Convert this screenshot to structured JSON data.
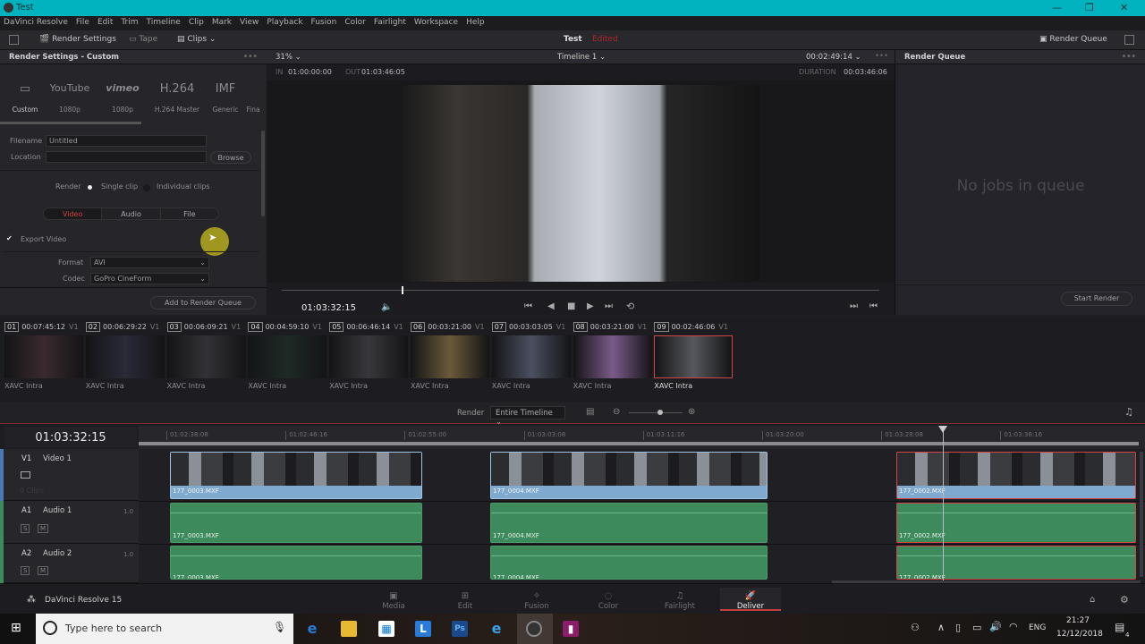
{
  "window": {
    "title": "Test",
    "min": "—",
    "max": "❐",
    "close": "✕"
  },
  "menu": [
    "DaVinci Resolve",
    "File",
    "Edit",
    "Trim",
    "Timeline",
    "Clip",
    "Mark",
    "View",
    "Playback",
    "Fusion",
    "Color",
    "Fairlight",
    "Workspace",
    "Help"
  ],
  "toolbar": {
    "render_settings": "Render Settings",
    "tape": "Tape",
    "clips": "Clips",
    "project": "Test",
    "status": "Edited",
    "render_queue": "Render Queue"
  },
  "render_settings": {
    "title": "Render Settings - Custom",
    "presets": [
      {
        "icon": "▭",
        "label": "Custom"
      },
      {
        "icon": "YouTube",
        "label": "1080p"
      },
      {
        "icon": "vimeo",
        "label": "1080p"
      },
      {
        "icon": "H.264",
        "label": "H.264 Master"
      },
      {
        "icon": "IMF",
        "label": "Generic"
      },
      {
        "icon": "",
        "label": "Fina"
      }
    ],
    "filename_label": "Filename",
    "filename": "Untitled",
    "location_label": "Location",
    "location": "",
    "browse": "Browse",
    "render_label": "Render",
    "single_clip": "Single clip",
    "individual_clips": "Individual clips",
    "tabs": [
      "Video",
      "Audio",
      "File"
    ],
    "export_video": "Export Video",
    "format_label": "Format",
    "format": "AVI",
    "codec_label": "Codec",
    "codec": "GoPro CineForm",
    "add_to_queue": "Add to Render Queue"
  },
  "viewer": {
    "zoom": "31%",
    "timeline": "Timeline 1",
    "timecode": "00:02:49:14",
    "in_label": "IN",
    "in": "01:00:00:00",
    "out_label": "OUT",
    "out": "01:03:46:05",
    "duration_label": "DURATION",
    "duration": "00:03:46:06",
    "current": "01:03:32:15",
    "playhead_fraction": 0.2
  },
  "render_queue": {
    "title": "Render Queue",
    "empty": "No jobs in queue",
    "start": "Start Render"
  },
  "clips": [
    {
      "num": "01",
      "tc": "00:07:45:12",
      "track": "V1",
      "codec": "XAVC Intra",
      "color": "#3a2a2e"
    },
    {
      "num": "02",
      "tc": "00:06:29:22",
      "track": "V1",
      "codec": "XAVC Intra",
      "color": "#2a2a38"
    },
    {
      "num": "03",
      "tc": "00:06:09:21",
      "track": "V1",
      "codec": "XAVC Intra",
      "color": "#323236"
    },
    {
      "num": "04",
      "tc": "00:04:59:10",
      "track": "V1",
      "codec": "XAVC Intra",
      "color": "#1e2a26"
    },
    {
      "num": "05",
      "tc": "00:06:46:14",
      "track": "V1",
      "codec": "XAVC Intra",
      "color": "#38383c"
    },
    {
      "num": "06",
      "tc": "00:03:21:00",
      "track": "V1",
      "codec": "XAVC Intra",
      "color": "#6a5a3a"
    },
    {
      "num": "07",
      "tc": "00:03:03:05",
      "track": "V1",
      "codec": "XAVC Intra",
      "color": "#4a5060"
    },
    {
      "num": "08",
      "tc": "00:03:21:00",
      "track": "V1",
      "codec": "XAVC Intra",
      "color": "#7a5a88"
    },
    {
      "num": "09",
      "tc": "00:02:46:06",
      "track": "V1",
      "codec": "XAVC Intra",
      "color": "#55585e"
    }
  ],
  "timeline": {
    "render_label": "Render",
    "render_mode": "Entire Timeline",
    "timecode": "01:03:32:15",
    "ticks": [
      "01:02:38:08",
      "01:02:46:16",
      "01:02:55:00",
      "01:03:03:08",
      "01:03:11:16",
      "01:03:20:00",
      "01:03:28:08",
      "01:03:36:16"
    ],
    "tracks": [
      {
        "id": "V1",
        "name": "Video 1",
        "extra": "9 Clips"
      },
      {
        "id": "A1",
        "name": "Audio 1",
        "level": "1.0"
      },
      {
        "id": "A2",
        "name": "Audio 2",
        "level": "1.0"
      }
    ],
    "solo": "S",
    "mute": "M",
    "clip_names": [
      "177_0003.MXF",
      "177_0004.MXF",
      "177_0002.MXF"
    ]
  },
  "pages": [
    "Media",
    "Edit",
    "Fusion",
    "Color",
    "Fairlight",
    "Deliver"
  ],
  "app_name": "DaVinci Resolve 15",
  "taskbar": {
    "search": "Type here to search",
    "lang": "ENG",
    "time": "21:27",
    "date": "12/12/2018",
    "notif": "4"
  }
}
